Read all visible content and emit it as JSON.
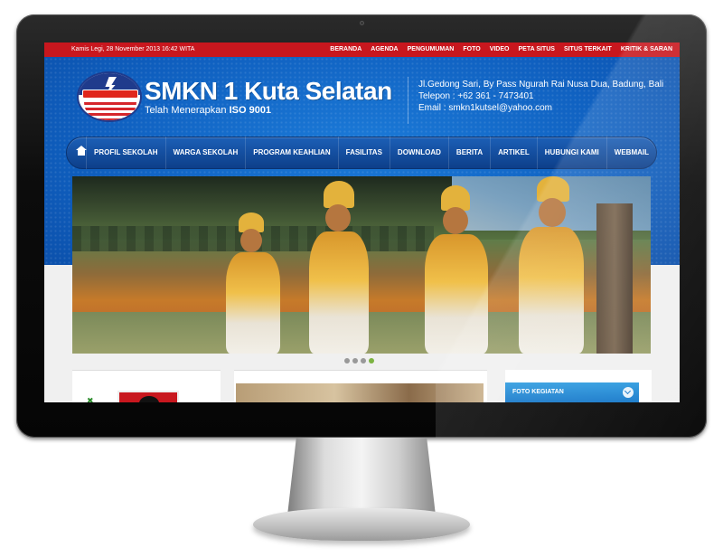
{
  "topbar": {
    "date": "Kamis Legi,  28 November 2013 16:42 WITA",
    "links": [
      "BERANDA",
      "AGENDA",
      "PENGUMUMAN",
      "FOTO",
      "VIDEO",
      "PETA SITUS",
      "SITUS TERKAIT",
      "KRITIK & SARAN"
    ]
  },
  "header": {
    "title": "SMKN 1 Kuta Selatan",
    "subtitle_prefix": "Telah Menerapkan",
    "subtitle_bold": "ISO 9001",
    "logo_text": "SMKN 1 KUTA SELATAN",
    "address": "Jl.Gedong Sari, By Pass Ngurah Rai Nusa Dua, Badung, Bali",
    "phone": "Telepon : +62 361 - 7473401",
    "email": "Email : smkn1kutsel@yahoo.com"
  },
  "mainnav": {
    "home_icon": "home-icon",
    "items": [
      "PROFIL SEKOLAH",
      "WARGA SEKOLAH",
      "PROGRAM KEAHLIAN",
      "FASILITAS",
      "DOWNLOAD",
      "BERITA",
      "ARTIKEL",
      "HUBUNGI KAMI",
      "WEBMAIL"
    ]
  },
  "slider": {
    "dot_count": 4,
    "active_dot": 4
  },
  "sidebar_right": {
    "heading": "FOTO KEGIATAN"
  },
  "colors": {
    "topbar": "#c8171e",
    "header_blue": "#1b7ad8",
    "nav_blue": "#0d3f8a",
    "accent_green": "#7cb342"
  }
}
